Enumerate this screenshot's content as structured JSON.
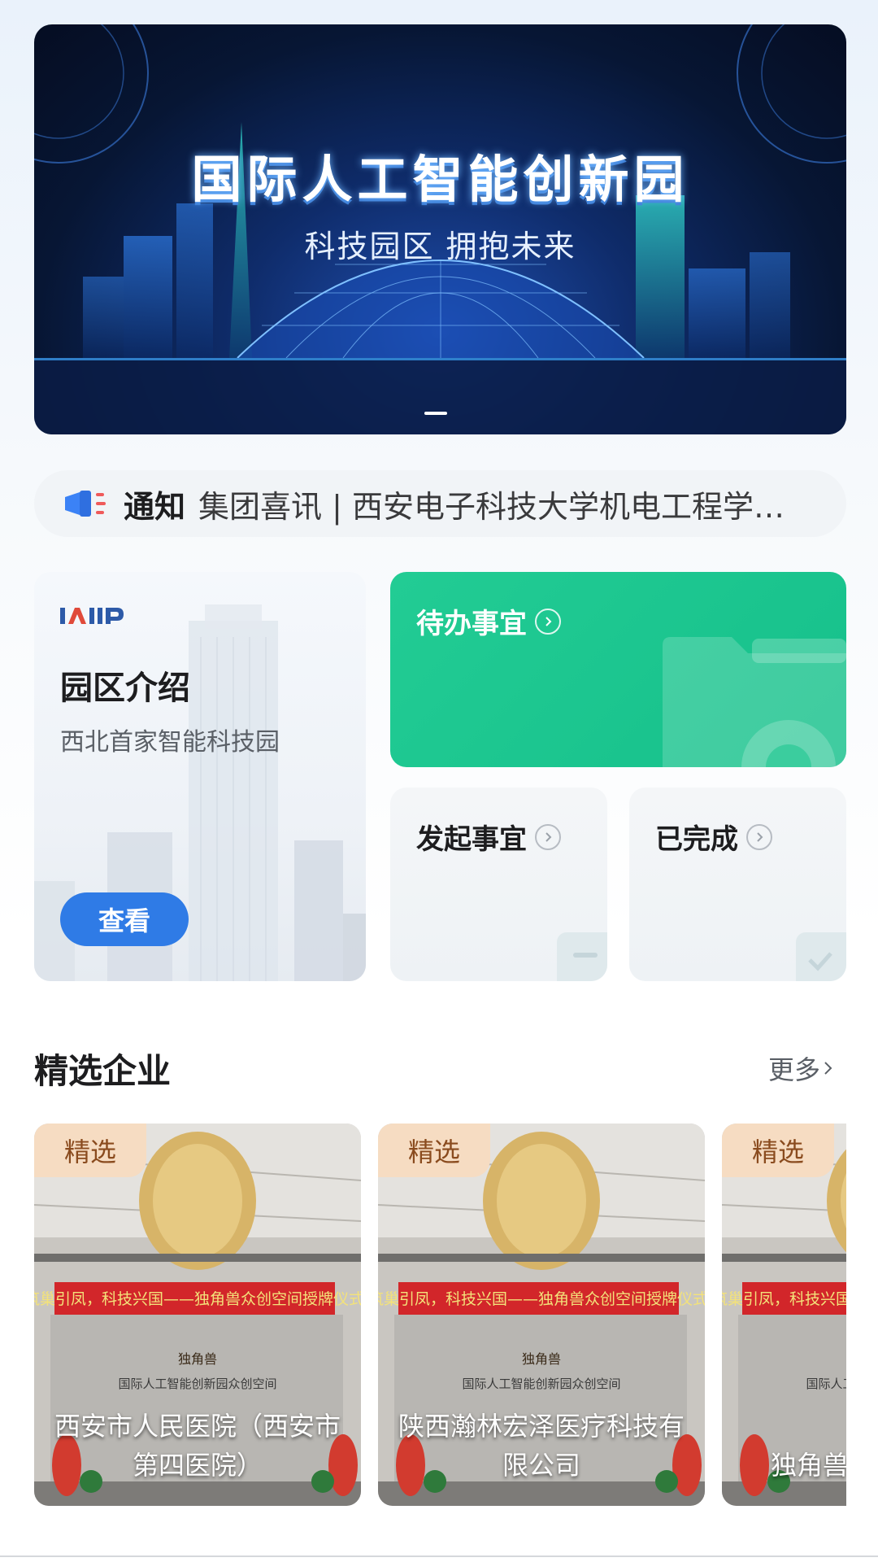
{
  "banner": {
    "title": "国际人工智能创新园",
    "subtitle": "科技园区  拥抱未来"
  },
  "notice": {
    "icon": "megaphone-icon",
    "label": "通知",
    "text": "集团喜讯 | 西安电子科技大学机电工程学院……"
  },
  "park_intro": {
    "logo_text": "IAIIP",
    "title": "园区介绍",
    "subtitle": "西北首家智能科技园",
    "button": "查看"
  },
  "tasks": {
    "todo": "待办事宜",
    "initiate": "发起事宜",
    "done": "已完成"
  },
  "featured": {
    "title": "精选企业",
    "more": "更多",
    "items": [
      {
        "tag": "精选",
        "name": "西安市人民医院（西安市第四医院）"
      },
      {
        "tag": "精选",
        "name": "陕西瀚林宏泽医疗科技有限公司"
      },
      {
        "tag": "精选",
        "name": "独角兽"
      }
    ]
  },
  "photo": {
    "banner_text": "筑巢引凤，科技兴国——独角兽众创空间授牌仪式",
    "brand": "独角兽",
    "wall_text": "国际人工智能创新园众创空间"
  },
  "colors": {
    "accent_blue": "#2f7be6",
    "todo_green": "#1ec790",
    "tag_bg": "#f6dcc2",
    "tag_text": "#8a4b1e"
  }
}
